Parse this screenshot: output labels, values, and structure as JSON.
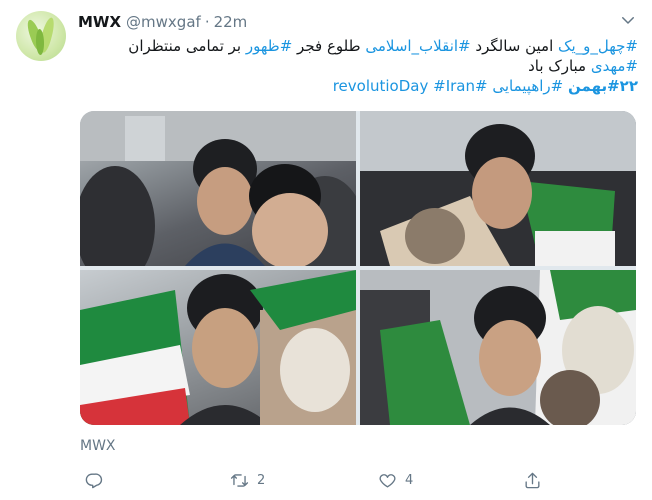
{
  "user": {
    "display_name": "MWX",
    "handle": "@mwxgaf",
    "separator": "·",
    "time": "22m"
  },
  "tweet": {
    "line1": [
      {
        "text": "#چهل_و_یک",
        "type": "tag"
      },
      {
        "text": " امین سالگرد ",
        "type": "text"
      },
      {
        "text": "#انقلاب_اسلامی",
        "type": "tag"
      },
      {
        "text": "  طلوع فجر ",
        "type": "text"
      },
      {
        "text": "#ظهور",
        "type": "tag"
      },
      {
        "text": " بر تمامی منتظران",
        "type": "text"
      }
    ],
    "line2": [
      {
        "text": "#مهدی",
        "type": "tag"
      },
      {
        "text": " مبارک باد",
        "type": "text"
      }
    ],
    "line3": [
      {
        "text": "#۲۲بهمن",
        "type": "tag-bold"
      },
      {
        "text": " ",
        "type": "text"
      },
      {
        "text": "#راهپیمایی",
        "type": "tag"
      },
      {
        "text": " ",
        "type": "text"
      },
      {
        "text": "#revolutioDay",
        "type": "tag"
      },
      {
        "text": " ",
        "type": "text"
      },
      {
        "text": "#Iran",
        "type": "tag"
      }
    ]
  },
  "source_label": "MWX",
  "actions": {
    "reply_count": "",
    "retweet_count": "2",
    "like_count": "4"
  },
  "icons": [
    "chevron-down-icon",
    "reply-icon",
    "retweet-icon",
    "like-icon",
    "share-icon"
  ],
  "colors": {
    "link": "#1b95e0",
    "secondary_text": "#657786",
    "primary_text": "#14171a"
  }
}
